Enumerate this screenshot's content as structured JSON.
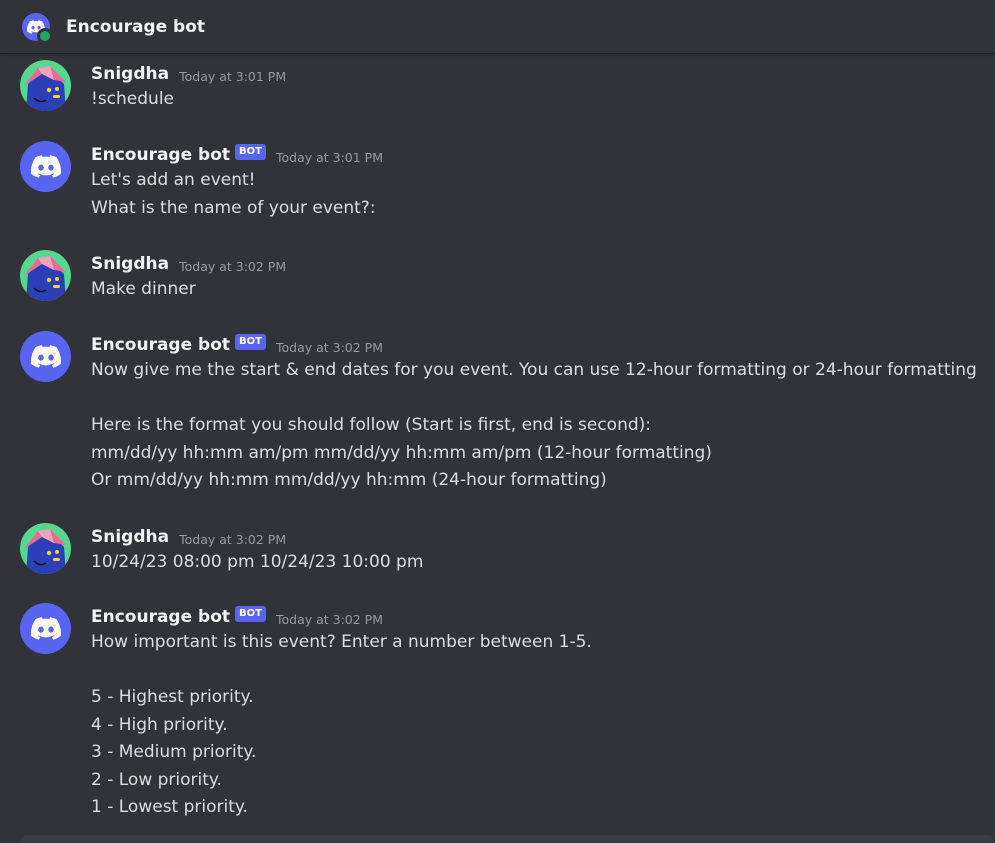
{
  "header": {
    "title": "Encourage bot",
    "status_color": "#23a55a",
    "accent_color": "#5865f2"
  },
  "messages": [
    {
      "author": "Snigdha",
      "is_bot": false,
      "timestamp": "Today at 3:01 PM",
      "lines": [
        "!schedule"
      ]
    },
    {
      "author": "Encourage bot",
      "is_bot": true,
      "bot_tag": "BOT",
      "timestamp": "Today at 3:01 PM",
      "lines": [
        "Let's add an event!",
        "What is the name of your event?:"
      ]
    },
    {
      "author": "Snigdha",
      "is_bot": false,
      "timestamp": "Today at 3:02 PM",
      "lines": [
        "Make dinner"
      ]
    },
    {
      "author": "Encourage bot",
      "is_bot": true,
      "bot_tag": "BOT",
      "timestamp": "Today at 3:02 PM",
      "lines": [
        "Now give me the start & end dates for you event. You can use 12-hour formatting or 24-hour formatting",
        "",
        "Here is the format you should follow (Start is first, end is second):",
        "mm/dd/yy hh:mm am/pm mm/dd/yy hh:mm am/pm (12-hour formatting)",
        "Or mm/dd/yy hh:mm mm/dd/yy hh:mm (24-hour formatting)"
      ]
    },
    {
      "author": "Snigdha",
      "is_bot": false,
      "timestamp": "Today at 3:02 PM",
      "lines": [
        "10/24/23 08:00 pm 10/24/23 10:00 pm"
      ]
    },
    {
      "author": "Encourage bot",
      "is_bot": true,
      "bot_tag": "BOT",
      "timestamp": "Today at 3:02 PM",
      "lines": [
        "How important is this event? Enter a number between 1-5.",
        "",
        "5 - Highest priority.",
        "4 - High priority.",
        "3 - Medium priority.",
        "2 - Low priority.",
        "1 - Lowest priority."
      ]
    }
  ]
}
